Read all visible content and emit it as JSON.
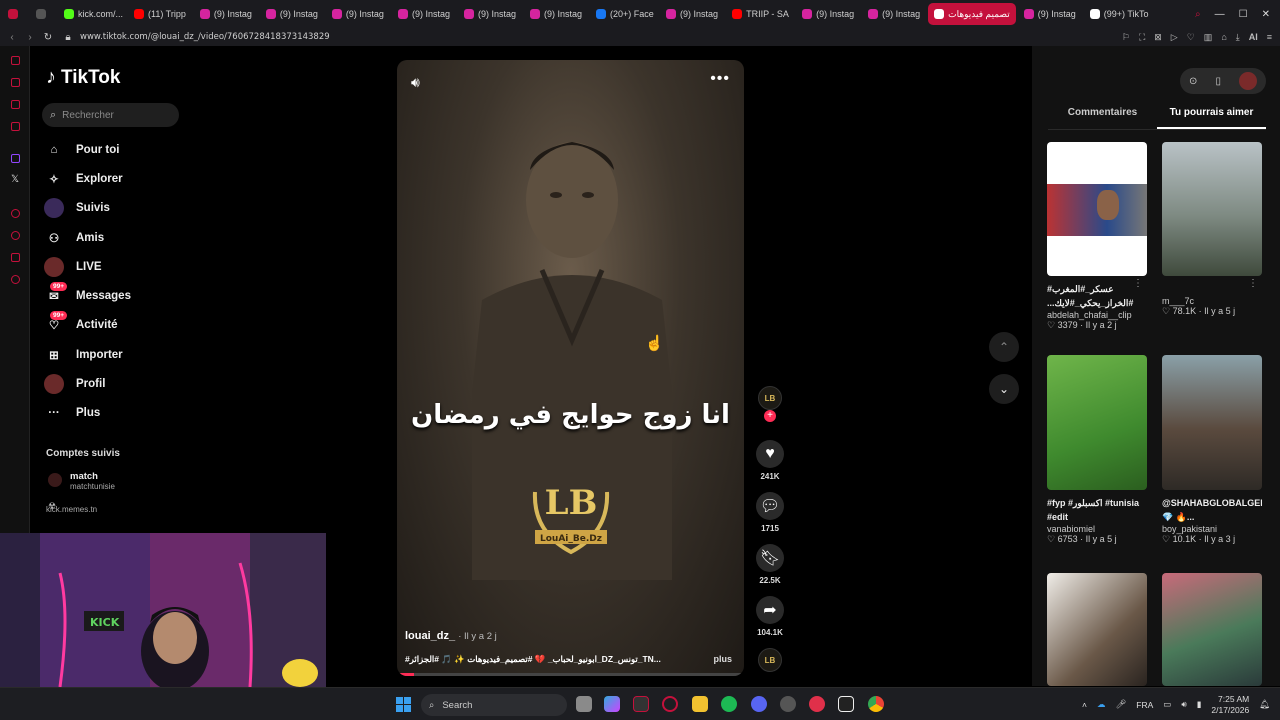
{
  "browser": {
    "tabs": [
      {
        "label": "",
        "color": "#c4113c"
      },
      {
        "label": "",
        "color": "#555"
      },
      {
        "label": "kick.com/...",
        "color": "#53fc18"
      },
      {
        "label": "(11) Tripp",
        "color": "#ff0000"
      },
      {
        "label": "(9) Instag",
        "color": "#d6249f"
      },
      {
        "label": "(9) Instag",
        "color": "#d6249f"
      },
      {
        "label": "(9) Instag",
        "color": "#d6249f"
      },
      {
        "label": "(9) Instag",
        "color": "#d6249f"
      },
      {
        "label": "(9) Instag",
        "color": "#d6249f"
      },
      {
        "label": "(9) Instag",
        "color": "#d6249f"
      },
      {
        "label": "(20+) Face",
        "color": "#1877f2"
      },
      {
        "label": "(9) Instag",
        "color": "#d6249f"
      },
      {
        "label": "TRIIP - SA",
        "color": "#ff0000"
      },
      {
        "label": "(9) Instag",
        "color": "#d6249f"
      },
      {
        "label": "(9) Instag",
        "color": "#d6249f"
      },
      {
        "label": "تصميم فيديوهات",
        "color": "#ffffff",
        "active": true
      },
      {
        "label": "(9) Instag",
        "color": "#d6249f"
      },
      {
        "label": "(99+) TikTo",
        "color": "#ffffff"
      }
    ],
    "url": "www.tiktok.com/@louai_dz_/video/7606728418373143829",
    "ai_label": "AI"
  },
  "sidebar": {
    "brand": "TikTok",
    "search_placeholder": "Rechercher",
    "items": [
      {
        "label": "Pour toi",
        "icon": "home-icon"
      },
      {
        "label": "Explorer",
        "icon": "compass-icon"
      },
      {
        "label": "Suivis",
        "icon": "following-icon"
      },
      {
        "label": "Amis",
        "icon": "friends-icon"
      },
      {
        "label": "LIVE",
        "icon": "live-icon"
      },
      {
        "label": "Messages",
        "icon": "messages-icon",
        "badge": "99+"
      },
      {
        "label": "Activité",
        "icon": "activity-icon",
        "badge": "99+"
      },
      {
        "label": "Importer",
        "icon": "upload-icon"
      },
      {
        "label": "Profil",
        "icon": "profile-icon"
      },
      {
        "label": "Plus",
        "icon": "more-icon"
      }
    ],
    "following_title": "Comptes suivis",
    "following": [
      {
        "name": "match",
        "handle": "matchtunisie"
      },
      {
        "name": "",
        "handle": "kick.memes.tn"
      }
    ]
  },
  "video": {
    "caption": "انا زوج حوايج في رمضان",
    "watermark": "LouAi_Be.Dz",
    "author": "louai_dz_",
    "posted": "· Il y a 2 j",
    "description": "#ابونيو_لحباب_ 💔 #تصميم_فيديوهات ✨ 🎵 #الجزائر_DZ_تونس_TN...",
    "more_label": "plus",
    "progress": 0.05
  },
  "actions": {
    "likes": "241K",
    "comments": "1715",
    "saves": "22.5K",
    "shares": "104.1K"
  },
  "right_panel": {
    "tabs": [
      "Commentaires",
      "Tu pourrais aimer"
    ],
    "active_tab": 1,
    "cards": [
      {
        "caption": "عسكر_#المغرب# #الخراز_يحكي_#لايك...",
        "user": "abdelah_chafai__clip",
        "likes": "3379",
        "age": "Il y a 2 j"
      },
      {
        "caption": "",
        "user": "m___7c",
        "likes": "78.1K",
        "age": "Il y a 5 j"
      },
      {
        "caption": "#fyp #اكسبلور #tunisia #edit",
        "user": "vanabiomiel",
        "likes": "6753",
        "age": "Il y a 5 j"
      },
      {
        "caption": "@SHAHABGLOBALGEMS 💎 🔥...",
        "user": "boy_pakistani",
        "likes": "10.1K",
        "age": "Il y a 3 j"
      }
    ]
  },
  "taskbar": {
    "search_label": "Search",
    "lang": "FRA",
    "time": "7:25 AM",
    "date": "2/17/2026"
  },
  "colors": {
    "accent": "#fe2c55",
    "brand_active_tab": "#c4113c"
  }
}
